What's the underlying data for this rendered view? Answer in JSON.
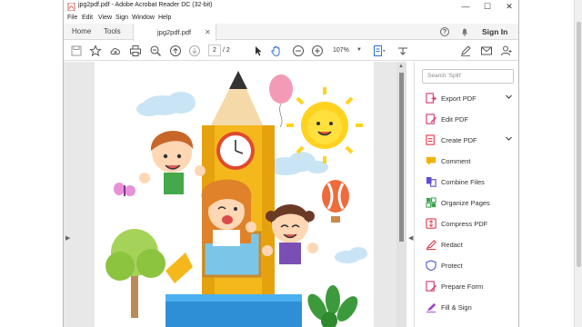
{
  "window": {
    "title": "jpg2pdf.pdf - Adobe Acrobat Reader DC (32-bit)",
    "controls": {
      "minimize": "—",
      "maximize": "☐",
      "close": "✕"
    }
  },
  "menu": [
    "File",
    "Edit",
    "View",
    "Sign",
    "Window",
    "Help"
  ],
  "tabs": {
    "home": "Home",
    "tools": "Tools",
    "document": "jpg2pdf.pdf",
    "sign_in": "Sign In"
  },
  "toolbar": {
    "page_current": "2",
    "page_total": "/ 2",
    "zoom": "107%"
  },
  "tools_pane": {
    "search_placeholder": "Search 'Split'",
    "items": [
      {
        "label": "Export PDF",
        "icon": "export-pdf-icon",
        "color": "#d6396b",
        "expandable": true
      },
      {
        "label": "Edit PDF",
        "icon": "edit-pdf-icon",
        "color": "#d6396b",
        "expandable": false
      },
      {
        "label": "Create PDF",
        "icon": "create-pdf-icon",
        "color": "#e0394b",
        "expandable": true
      },
      {
        "label": "Comment",
        "icon": "comment-icon",
        "color": "#f0b400",
        "expandable": false
      },
      {
        "label": "Combine Files",
        "icon": "combine-files-icon",
        "color": "#5a4fcf",
        "expandable": false
      },
      {
        "label": "Organize Pages",
        "icon": "organize-pages-icon",
        "color": "#3aa34a",
        "expandable": false
      },
      {
        "label": "Compress PDF",
        "icon": "compress-pdf-icon",
        "color": "#e0394b",
        "expandable": false
      },
      {
        "label": "Redact",
        "icon": "redact-icon",
        "color": "#e0394b",
        "expandable": false
      },
      {
        "label": "Protect",
        "icon": "protect-icon",
        "color": "#4a5ecf",
        "expandable": false
      },
      {
        "label": "Prepare Form",
        "icon": "prepare-form-icon",
        "color": "#d6396b",
        "expandable": false
      },
      {
        "label": "Fill & Sign",
        "icon": "fill-sign-icon",
        "color": "#9a3fcf",
        "expandable": false
      }
    ]
  },
  "colors": {
    "accent": "#d6396b",
    "hand_tool": "#2d6fd6"
  }
}
